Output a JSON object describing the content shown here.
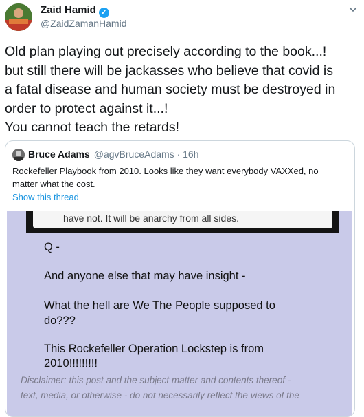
{
  "author": {
    "name": "Zaid Hamid",
    "handle": "@ZaidZamanHamid",
    "verified_symbol": "✓"
  },
  "tweet": {
    "lines": [
      "Old plan playing out precisely according to the book...!",
      "but still there will be jackasses who believe that covid is",
      "a fatal disease and human society must be destroyed in",
      "order to protect against it...!",
      "You cannot teach the retards!"
    ]
  },
  "quote": {
    "name": "Bruce Adams",
    "handle_time": "@agvBruceAdams · 16h",
    "text_lines": [
      "Rockefeller Playbook from 2010.  Looks like they want everybody VAXXed, no",
      "matter what the cost."
    ],
    "show_thread": "Show this thread",
    "image": {
      "strip_text": "have not. It will be anarchy from all sides.",
      "lines": [
        "Q -",
        "And anyone else that may have insight -",
        "What the hell are We The People supposed to",
        "do???",
        "This Rockefeller Operation Lockstep is from",
        "2010!!!!!!!!!"
      ],
      "disclaimer_lines": [
        "Disclaimer: this post and the subject matter and contents thereof -",
        "text, media, or otherwise - do not necessarily reflect the views of the"
      ]
    }
  },
  "icons": {
    "caret": "chevron-down-icon",
    "verified": "verified-badge-icon"
  },
  "colors": {
    "accent": "#1b95e0",
    "verified": "#1da1f2",
    "image_bg": "#c9cae9"
  }
}
